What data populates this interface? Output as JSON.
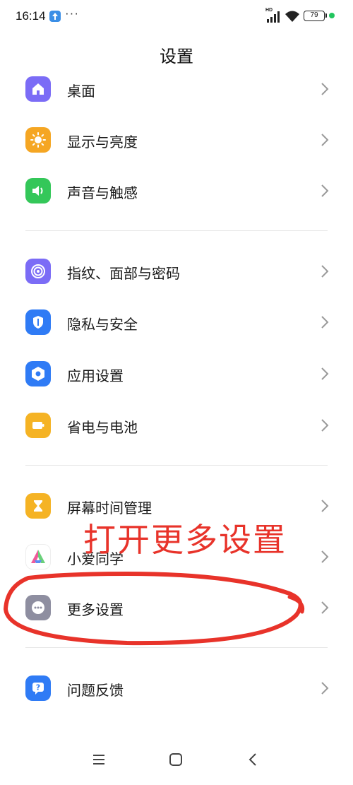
{
  "status_bar": {
    "time": "16:14",
    "more_notifications": "···",
    "network_label": "HD",
    "battery_level": "79",
    "charging_color": "#22c55e"
  },
  "page": {
    "title": "设置"
  },
  "menu_items": [
    {
      "label": "桌面",
      "icon": "home-icon",
      "color": "#7b6cf6"
    },
    {
      "label": "显示与亮度",
      "icon": "sun-icon",
      "color": "#f5a623"
    },
    {
      "label": "声音与触感",
      "icon": "speaker-icon",
      "color": "#34c759"
    },
    {
      "label": "指纹、面部与密码",
      "icon": "fingerprint-icon",
      "color": "#7b6cf6"
    },
    {
      "label": "隐私与安全",
      "icon": "privacy-shield-icon",
      "color": "#2f7bf5"
    },
    {
      "label": "应用设置",
      "icon": "hexagon-settings-icon",
      "color": "#2f7bf5"
    },
    {
      "label": "省电与电池",
      "icon": "battery-icon",
      "color": "#f5b324"
    },
    {
      "label": "屏幕时间管理",
      "icon": "hourglass-icon",
      "color": "#f5b324"
    },
    {
      "label": "小爱同学",
      "icon": "xiaoai-icon",
      "color": "#ffffff"
    },
    {
      "label": "更多设置",
      "icon": "more-dots-icon",
      "color": "#8e8ea0"
    },
    {
      "label": "问题反馈",
      "icon": "feedback-icon",
      "color": "#2f7bf5"
    }
  ],
  "annotation": {
    "text": "打开更多设置",
    "color": "#e8332a"
  },
  "nav_bar": {
    "menu": "menu-icon",
    "home": "home-square-icon",
    "back": "back-icon"
  }
}
